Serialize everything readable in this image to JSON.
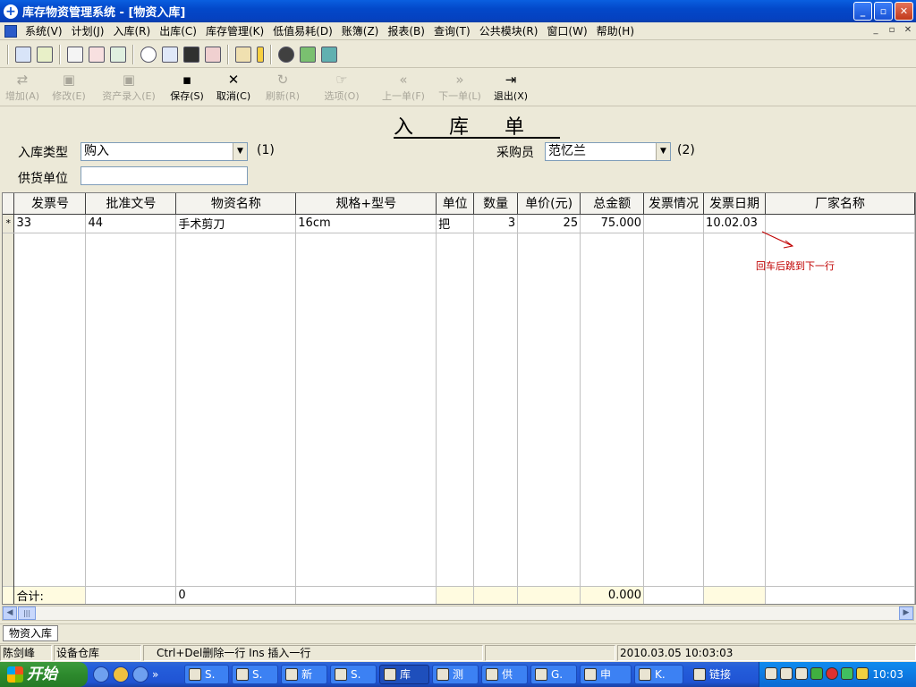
{
  "window": {
    "title": "库存物资管理系统 - [物资入库]"
  },
  "menu": {
    "items": [
      "系统(V)",
      "计划(J)",
      "入库(R)",
      "出库(C)",
      "库存管理(K)",
      "低值易耗(D)",
      "账簿(Z)",
      "报表(B)",
      "查询(T)",
      "公共模块(R)",
      "窗口(W)",
      "帮助(H)"
    ]
  },
  "actions": [
    {
      "label": "增加(A)",
      "icon": "add-icon",
      "enabled": false
    },
    {
      "label": "修改(E)",
      "icon": "edit-icon",
      "enabled": false
    },
    {
      "label": "资产录入(E)",
      "icon": "asset-entry-icon",
      "enabled": false
    },
    {
      "label": "保存(S)",
      "icon": "save-icon",
      "enabled": true
    },
    {
      "label": "取消(C)",
      "icon": "cancel-icon",
      "enabled": true
    },
    {
      "label": "刷新(R)",
      "icon": "refresh-icon",
      "enabled": false
    },
    {
      "label": "选项(O)",
      "icon": "options-icon",
      "enabled": false
    },
    {
      "label": "上一单(F)",
      "icon": "prev-icon",
      "enabled": false
    },
    {
      "label": "下一单(L)",
      "icon": "next-icon",
      "enabled": false
    },
    {
      "label": "退出(X)",
      "icon": "exit-icon",
      "enabled": true
    }
  ],
  "form": {
    "title": "入库单",
    "type_label": "入库类型",
    "type_value": "购入",
    "hint1": "(1)",
    "buyer_label": "采购员",
    "buyer_value": "范忆兰",
    "hint2": "(2)",
    "supplier_label": "供货单位",
    "supplier_value": ""
  },
  "grid": {
    "columns": [
      "发票号",
      "批准文号",
      "物资名称",
      "规格+型号",
      "单位",
      "数量",
      "单价(元)",
      "总金额",
      "发票情况",
      "发票日期",
      "厂家名称"
    ],
    "rows": [
      {
        "indicator": "*",
        "cells": [
          "33",
          "44",
          "手术剪刀",
          "16cm",
          "把",
          "3",
          "25",
          "75.000",
          "",
          "10.02.03",
          ""
        ]
      }
    ],
    "total": {
      "label": "合计:",
      "name_total": "0",
      "amount_total": "0.000"
    }
  },
  "annotation": {
    "note": "回车后跳到下一行"
  },
  "mdi_tab": {
    "label": "物资入库"
  },
  "status": {
    "user": "陈剑峰",
    "warehouse": "设备仓库",
    "shortcuts": "Ctrl+Del删除一行  Ins 插入一行",
    "datetime": "2010.03.05 10:03:03"
  },
  "taskbar": {
    "start": "开始",
    "tasks": [
      {
        "label": "S.",
        "active": false
      },
      {
        "label": "S.",
        "active": false
      },
      {
        "label": "新",
        "active": false
      },
      {
        "label": "S.",
        "active": false
      },
      {
        "label": "库",
        "active": true
      },
      {
        "label": "测",
        "active": false
      },
      {
        "label": "供",
        "active": false
      },
      {
        "label": "G.",
        "active": false
      },
      {
        "label": "申",
        "active": false
      },
      {
        "label": "K.",
        "active": false
      }
    ],
    "links_label": "链接",
    "clock": "10:03"
  },
  "colors": {
    "title_bar": "#0348c9",
    "note_red": "#c00000",
    "total_row": "#fffbe0",
    "start_green": "#2d8a2d"
  }
}
